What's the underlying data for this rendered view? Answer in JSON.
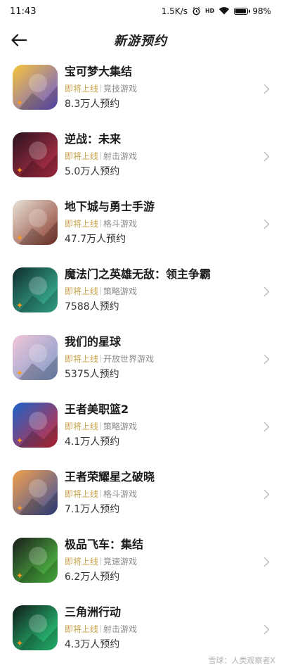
{
  "status_bar": {
    "time": "11:43",
    "net_speed": "1.5K/s",
    "alarm_icon": "alarm-clock-icon",
    "hd_label": "HD",
    "wifi_icon": "wifi-icon",
    "battery_percent": "98%",
    "battery_level": 0.98
  },
  "header": {
    "title": "新游预约",
    "back_icon": "arrow-left-icon"
  },
  "colors": {
    "status_tag": "#c9a24a",
    "meta_text": "#8a8a8a",
    "title_text": "#1a1a1a",
    "chevron": "#c7c7c7",
    "badge": "#ff9a1f"
  },
  "games": [
    {
      "name": "宝可梦大集结",
      "status": "即将上线",
      "genre": "竞技游戏",
      "reservations": "8.3万人预约",
      "icon": "pokemon-unite-icon",
      "color_a": "#f6c53b",
      "color_b": "#6a57d8"
    },
    {
      "name": "逆战：未来",
      "status": "即将上线",
      "genre": "射击游戏",
      "reservations": "5.0万人预约",
      "icon": "nizhan-future-icon",
      "color_a": "#2a1420",
      "color_b": "#c4324b"
    },
    {
      "name": "地下城与勇士手游",
      "status": "即将上线",
      "genre": "格斗游戏",
      "reservations": "47.7万人预约",
      "icon": "dnf-mobile-icon",
      "color_a": "#e9e1d6",
      "color_b": "#8a3b2c"
    },
    {
      "name": "魔法门之英雄无敌：领主争霸",
      "status": "即将上线",
      "genre": "策略游戏",
      "reservations": "7588人预约",
      "icon": "heroes-might-magic-icon",
      "color_a": "#0f2a2a",
      "color_b": "#3fc9a6"
    },
    {
      "name": "我们的星球",
      "status": "即将上线",
      "genre": "开放世界游戏",
      "reservations": "5375人预约",
      "icon": "our-planet-icon",
      "color_a": "#f1c6d8",
      "color_b": "#7c9acb"
    },
    {
      "name": "王者美职篮2",
      "status": "即将上线",
      "genre": "策略游戏",
      "reservations": "4.1万人预约",
      "icon": "nba-kings-icon",
      "color_a": "#1b63c9",
      "color_b": "#d92b3a"
    },
    {
      "name": "王者荣耀星之破晓",
      "status": "即将上线",
      "genre": "格斗游戏",
      "reservations": "7.1万人预约",
      "icon": "honor-of-kings-star-icon",
      "color_a": "#f3a04c",
      "color_b": "#3a4f9c"
    },
    {
      "name": "极品飞车：集结",
      "status": "即将上线",
      "genre": "竞速游戏",
      "reservations": "6.2万人预约",
      "icon": "need-for-speed-icon",
      "color_a": "#1a1a1a",
      "color_b": "#58d64a"
    },
    {
      "name": "三角洲行动",
      "status": "即将上线",
      "genre": "射击游戏",
      "reservations": "4.3万人预约",
      "icon": "delta-force-icon",
      "color_a": "#0f1a17",
      "color_b": "#2ee08a"
    }
  ],
  "watermark": "雪球：人类观察者X"
}
